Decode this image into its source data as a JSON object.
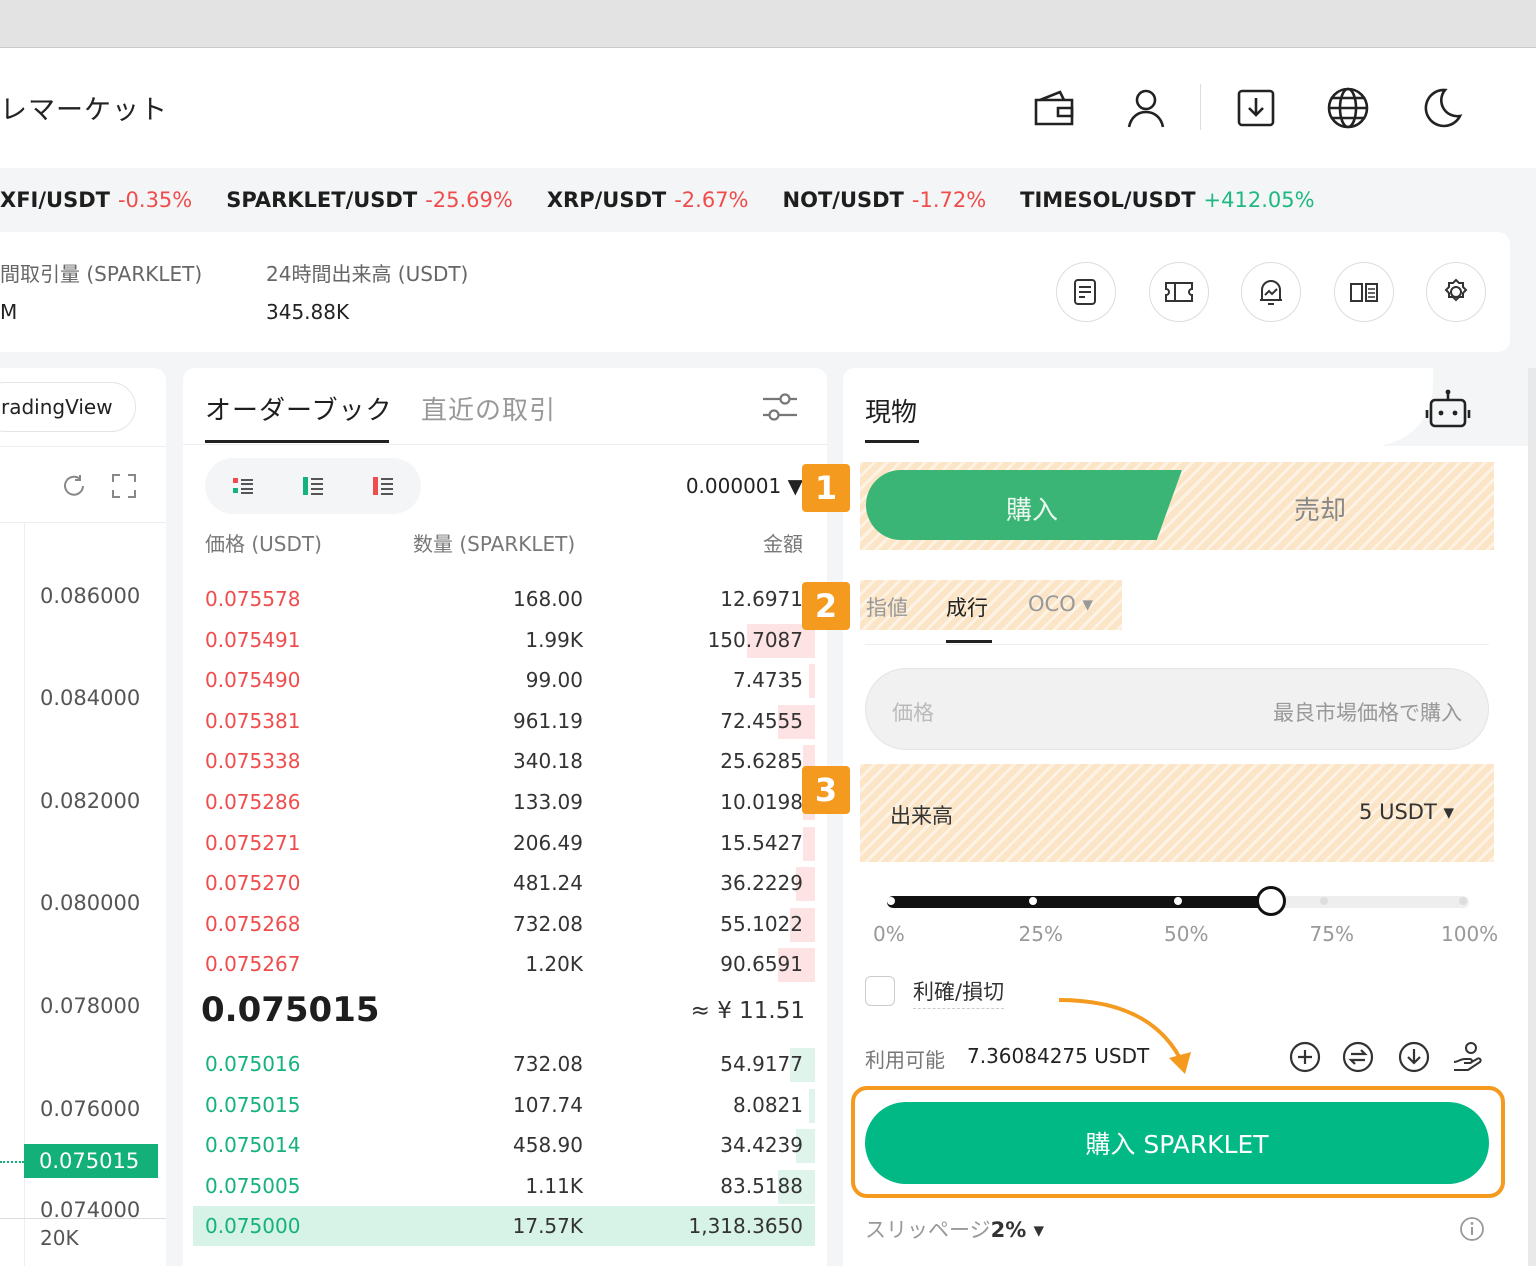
{
  "header": {
    "brand": "レマーケット",
    "icons": [
      "wallet-icon",
      "user-icon",
      "download-icon",
      "globe-icon",
      "moon-icon"
    ]
  },
  "ticker": [
    {
      "pair": "XFI/USDT",
      "change": "-0.35%",
      "dir": "neg"
    },
    {
      "pair": "SPARKLET/USDT",
      "change": "-25.69%",
      "dir": "neg"
    },
    {
      "pair": "XRP/USDT",
      "change": "-2.67%",
      "dir": "neg"
    },
    {
      "pair": "NOT/USDT",
      "change": "-1.72%",
      "dir": "neg"
    },
    {
      "pair": "TIMESOL/USDT",
      "change": "+412.05%",
      "dir": "pos"
    }
  ],
  "stats": {
    "vol_label": "間取引量 (SPARKLET)",
    "vol_value": "M",
    "turnover_label": "24時間出来高 (USDT)",
    "turnover_value": "345.88K",
    "icons": [
      "notes-icon",
      "ticket-icon",
      "alert-bell-icon",
      "book-icon",
      "settings-icon"
    ]
  },
  "chart": {
    "tradingview_label": "radingView",
    "y_labels": [
      "0.086000",
      "0.084000",
      "0.082000",
      "0.080000",
      "0.078000",
      "0.076000",
      "0.074000"
    ],
    "current_price": "0.075015",
    "volume_label": "20K"
  },
  "orderbook": {
    "tab_orderbook": "オーダーブック",
    "tab_trades": "直近の取引",
    "precision": "0.000001",
    "col_price": "価格 (USDT)",
    "col_qty": "数量 (SPARKLET)",
    "col_amount": "金額",
    "asks": [
      {
        "price": "0.075578",
        "qty": "168.00",
        "amount": "12.6971",
        "depth": 0.02
      },
      {
        "price": "0.075491",
        "qty": "1.99K",
        "amount": "150.7087",
        "depth": 0.11
      },
      {
        "price": "0.075490",
        "qty": "99.00",
        "amount": "7.4735",
        "depth": 0.01
      },
      {
        "price": "0.075381",
        "qty": "961.19",
        "amount": "72.4555",
        "depth": 0.06
      },
      {
        "price": "0.075338",
        "qty": "340.18",
        "amount": "25.6285",
        "depth": 0.02
      },
      {
        "price": "0.075286",
        "qty": "133.09",
        "amount": "10.0198",
        "depth": 0.02
      },
      {
        "price": "0.075271",
        "qty": "206.49",
        "amount": "15.5427",
        "depth": 0.02
      },
      {
        "price": "0.075270",
        "qty": "481.24",
        "amount": "36.2229",
        "depth": 0.03
      },
      {
        "price": "0.075268",
        "qty": "732.08",
        "amount": "55.1022",
        "depth": 0.04
      },
      {
        "price": "0.075267",
        "qty": "1.20K",
        "amount": "90.6591",
        "depth": 0.06
      }
    ],
    "mid_price": "0.075015",
    "mid_fiat": "≈ ¥ 11.51",
    "bids": [
      {
        "price": "0.075016",
        "qty": "732.08",
        "amount": "54.9177",
        "depth": 0.04
      },
      {
        "price": "0.075015",
        "qty": "107.74",
        "amount": "8.0821",
        "depth": 0.01
      },
      {
        "price": "0.075014",
        "qty": "458.90",
        "amount": "34.4239",
        "depth": 0.03
      },
      {
        "price": "0.075005",
        "qty": "1.11K",
        "amount": "83.5188",
        "depth": 0.06
      },
      {
        "price": "0.075000",
        "qty": "17.57K",
        "amount": "1,318.3650",
        "depth": 1.0
      }
    ]
  },
  "trade": {
    "tab_spot": "現物",
    "buy_label": "購入",
    "sell_label": "売却",
    "order_types": [
      "指値",
      "成行",
      "OCO ▾"
    ],
    "price_placeholder": "価格",
    "price_hint": "最良市場価格で購入",
    "volume_label": "出来高",
    "volume_unit": "5 USDT ▾",
    "slider_value": 0.66,
    "slider_marks": [
      "0%",
      "25%",
      "50%",
      "75%",
      "100%"
    ],
    "tpsl_label": "利確/損切",
    "available_label": "利用可能",
    "available_value": "7.36084275 USDT",
    "buy_button": "購入 SPARKLET",
    "slippage_label": "スリッページ",
    "slippage_value": "2% ▾"
  },
  "annotations": [
    "1",
    "2",
    "3"
  ],
  "colors": {
    "red": "#ef4d4d",
    "green": "#16b27b",
    "highlight": "#f39a1f"
  }
}
